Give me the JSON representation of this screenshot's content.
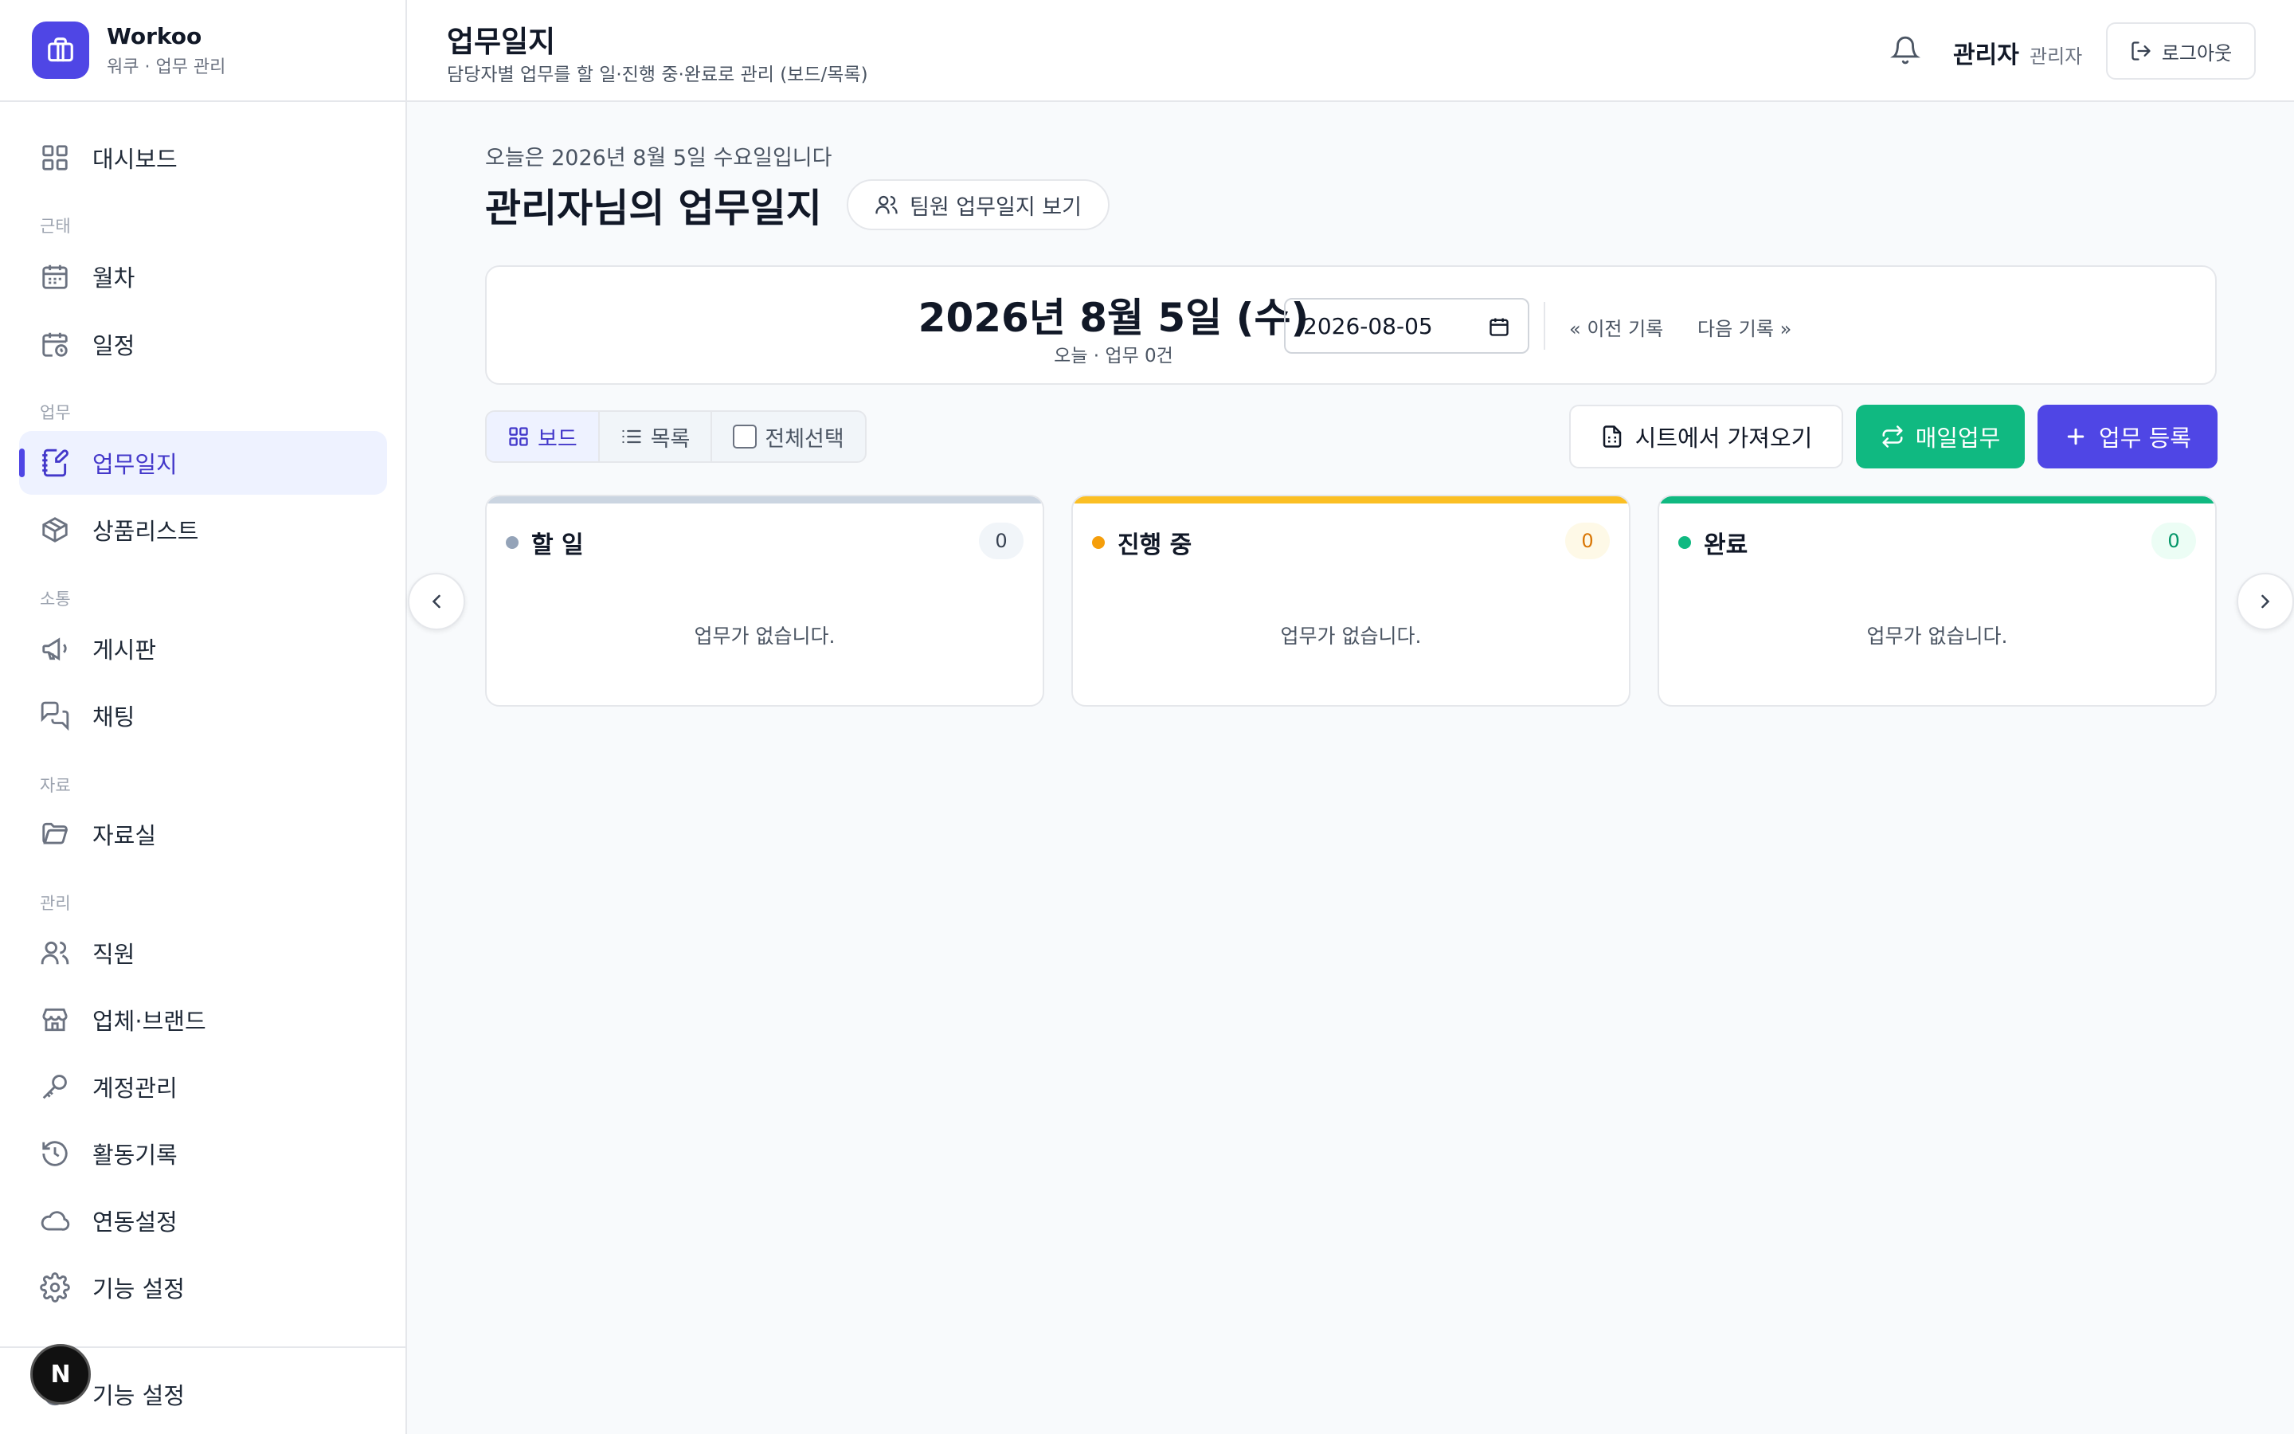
{
  "brand": {
    "name": "Workoo",
    "subtitle": "워쿠 · 업무 관리"
  },
  "sidebar": {
    "dashboard": "대시보드",
    "sections": [
      "근태",
      "업무",
      "소통",
      "자료",
      "관리"
    ],
    "items": [
      {
        "label": "월차",
        "icon": "calendar-icon"
      },
      {
        "label": "일정",
        "icon": "calendar-clock-icon"
      },
      {
        "label": "업무일지",
        "icon": "notebook-pen-icon",
        "active": true
      },
      {
        "label": "상품리스트",
        "icon": "package-icon"
      },
      {
        "label": "게시판",
        "icon": "megaphone-icon"
      },
      {
        "label": "채팅",
        "icon": "chat-icon"
      },
      {
        "label": "자료실",
        "icon": "folder-icon"
      },
      {
        "label": "직원",
        "icon": "users-icon"
      },
      {
        "label": "업체·브랜드",
        "icon": "store-icon"
      },
      {
        "label": "계정관리",
        "icon": "key-icon"
      },
      {
        "label": "활동기록",
        "icon": "history-icon"
      },
      {
        "label": "연동설정",
        "icon": "cloud-icon"
      },
      {
        "label": "기능 설정",
        "icon": "gear-icon"
      }
    ],
    "bottom_label": "기능 설정",
    "fab_letter": "N"
  },
  "header": {
    "title": "업무일지",
    "subtitle": "담당자별 업무를 할 일·진행 중·완료로 관리 (보드/목록)",
    "user_name": "관리자",
    "user_role": "관리자",
    "logout": "로그아웃"
  },
  "main": {
    "today_text": "오늘은 2026년 8월 5일 수요일입니다",
    "title": "관리자님의 업무일지",
    "team_button": "팀원 업무일지 보기",
    "date_big": "2026년 8월 5일 (수)",
    "date_sub": "오늘 · 업무 0건",
    "date_value": "2026-08-05",
    "prev": "« 이전 기록",
    "next": "다음 기록 »",
    "view_board": "보드",
    "view_list": "목록",
    "select_all": "전체선택",
    "btn_sheet": "시트에서 가져오기",
    "btn_daily": "매일업무",
    "btn_add": "업무 등록"
  },
  "columns": [
    {
      "title": "할 일",
      "count": "0",
      "empty": "업무가 없습니다.",
      "color": "#94a3b8"
    },
    {
      "title": "진행 중",
      "count": "0",
      "empty": "업무가 없습니다.",
      "color": "#fbbf24"
    },
    {
      "title": "완료",
      "count": "0",
      "empty": "업무가 없습니다.",
      "color": "#10b981"
    }
  ],
  "colors": {
    "accent": "#4f46e5",
    "success": "#10b981",
    "warning": "#fbbf24"
  }
}
